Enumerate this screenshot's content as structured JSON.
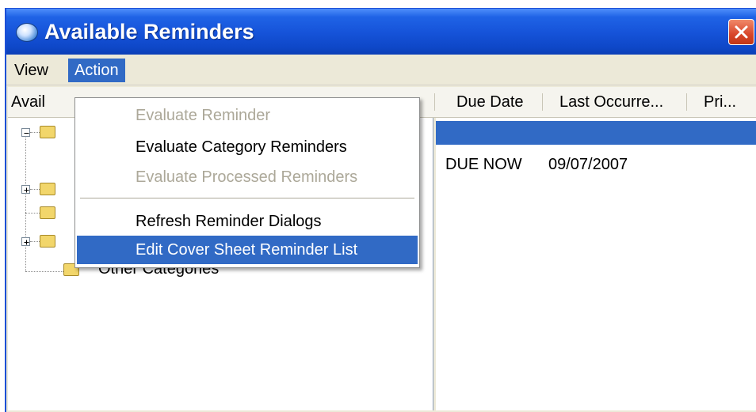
{
  "window": {
    "title": "Available Reminders"
  },
  "menubar": {
    "view_label": "View",
    "action_label": "Action"
  },
  "columns": {
    "available": "Avail",
    "due_date": "Due Date",
    "last_occurrence": "Last Occurre...",
    "priority": "Pri..."
  },
  "tree": {
    "partial_label": "Other Categories"
  },
  "reminder_row": {
    "due_date": "DUE NOW",
    "last_occurrence": "09/07/2007"
  },
  "action_menu": {
    "items": [
      {
        "label": "Evaluate Reminder",
        "enabled": false
      },
      {
        "label": "Evaluate Category Reminders",
        "enabled": true
      },
      {
        "label": "Evaluate Processed Reminders",
        "enabled": false
      },
      {
        "label": "Refresh Reminder Dialogs",
        "enabled": true
      },
      {
        "label": "Edit Cover Sheet Reminder List",
        "enabled": true,
        "highlighted": true
      }
    ]
  },
  "colors": {
    "titlebar": "#1552d8",
    "selection": "#316ac5",
    "disabled_text": "#aca899",
    "close_button": "#d8452a"
  }
}
